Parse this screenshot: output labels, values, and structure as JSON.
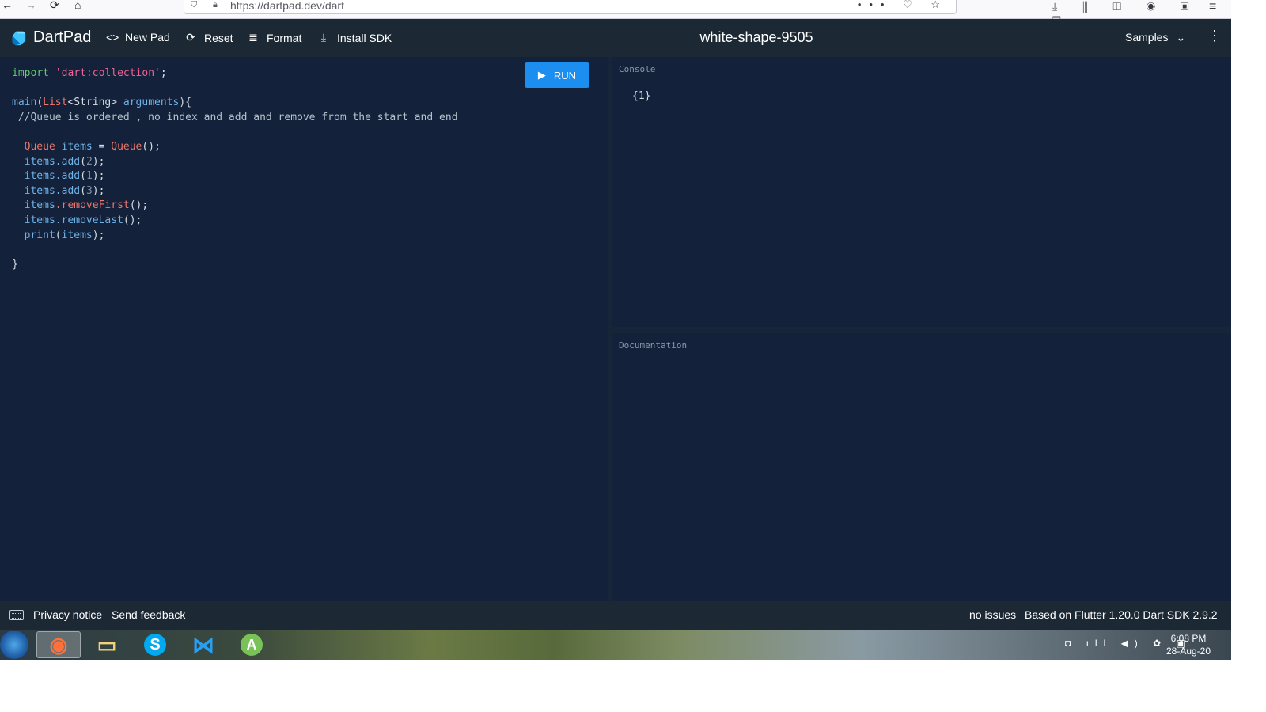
{
  "browser": {
    "url": "https://dartpad.dev/dart",
    "back": "←",
    "forward": "→",
    "reload": "⟳",
    "home": "⌂",
    "url_actions": "••• ♡ ☆",
    "toolbar_right": "⤓ ⫼ ◫ ◉ ▣ ▤",
    "menu": "≡"
  },
  "appbar": {
    "brand": "DartPad",
    "new_pad": "New Pad",
    "reset": "Reset",
    "format": "Format",
    "install_sdk": "Install SDK",
    "pad_name": "white-shape-9505",
    "samples": "Samples",
    "icons": {
      "new_pad": "<>",
      "reset": "⟳",
      "format": "≣",
      "install_sdk": "⤓",
      "samples_chevron": "⌄",
      "more": "⋮"
    }
  },
  "editor": {
    "run_label": "RUN",
    "run_icon": "▶",
    "code": {
      "l1_kw": "import",
      "l1_str": "'dart:collection'",
      "l1_end": ";",
      "l3_fn": "main",
      "l3_a": "(",
      "l3_type": "List",
      "l3_b": "<String> ",
      "l3_arg": "arguments",
      "l3_c": "){",
      "l4_com": " //Queue is ordered , no index and add and remove from the start and end",
      "l6_indent": "  ",
      "l6_type": "Queue",
      "l6_var": " items",
      "l6_eq": " = ",
      "l6_ctor": "Queue",
      "l6_end": "();",
      "items": "items",
      "add": ".add",
      "open": "(",
      "close": ");",
      "n1": "2",
      "n2": "1",
      "n3": "3",
      "remove_first": ".removeFirst",
      "remove_last": ".removeLast",
      "empty_call": "();",
      "print": "print",
      "brace": "}"
    }
  },
  "console": {
    "label": "Console",
    "output": "{1}"
  },
  "documentation": {
    "label": "Documentation"
  },
  "footer": {
    "privacy": "Privacy notice",
    "feedback": "Send feedback",
    "issues": "no issues",
    "version": "Based on Flutter 1.20.0 Dart SDK 2.9.2"
  },
  "taskbar": {
    "apps": [
      "firefox",
      "file-explorer",
      "skype",
      "vscode",
      "android-studio"
    ],
    "skype_glyph": "S",
    "vscode_glyph": "⋈",
    "android_glyph": "A",
    "explorer_glyph": "▭",
    "firefox_glyph": "◉",
    "tray_icons": "◘ ıll ◀) ✿ ▣",
    "time": "6:08 PM",
    "date": "28-Aug-20"
  },
  "colors": {
    "appbar": "#1c2834",
    "editor_bg": "#13213a",
    "run_button": "#1b8ef0",
    "keyword": "#68c970",
    "string": "#f06292",
    "function": "#6fb3e8",
    "type": "#f2776a"
  }
}
